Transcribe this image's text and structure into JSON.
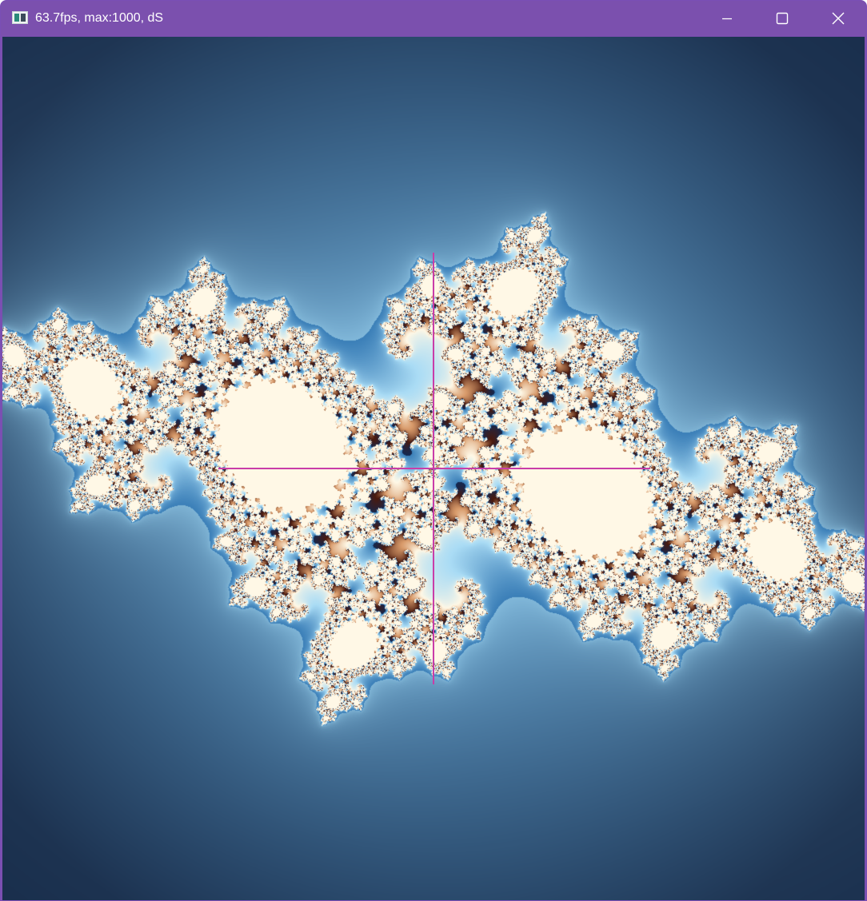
{
  "window": {
    "title": "63.7fps, max:1000, dS"
  },
  "titlebar": {
    "controls": [
      {
        "name": "minimize-button",
        "icon": "minimize-icon"
      },
      {
        "name": "maximize-button",
        "icon": "maximize-icon"
      },
      {
        "name": "close-button",
        "icon": "close-icon"
      }
    ]
  },
  "viewport": {
    "content": "julia-set-fractal",
    "crosshair_color": "#c93da8",
    "palette": {
      "background_dark": "#061634",
      "basin_blue": "#3b7fb8",
      "cream": "#fff8e6",
      "tan": "#d89a6a",
      "brown": "#4a1a0e"
    }
  }
}
